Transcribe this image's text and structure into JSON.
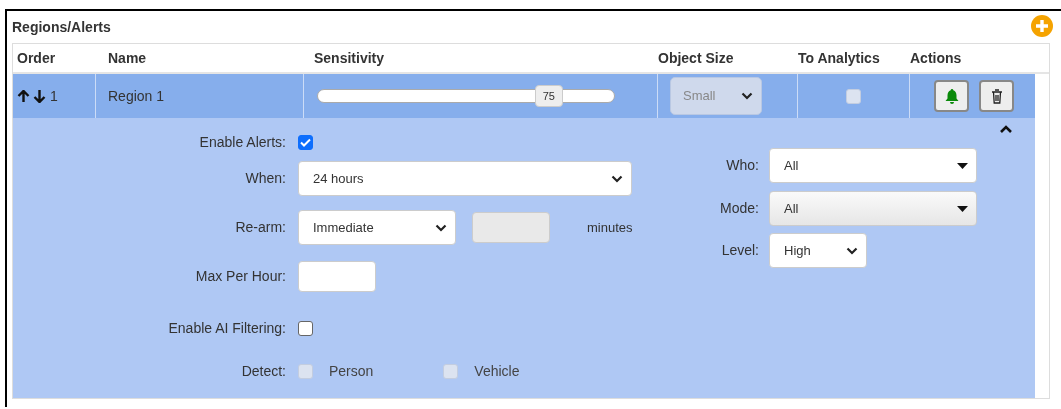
{
  "title": "Regions/Alerts",
  "table": {
    "columns": [
      "Order",
      "Name",
      "Sensitivity",
      "Object Size",
      "To Analytics",
      "Actions"
    ],
    "rows": [
      {
        "order": "1",
        "name": "Region 1",
        "selected": true,
        "expanded": true,
        "sensitivity": {
          "level": 0.78,
          "reading": "75"
        },
        "object_size": {
          "value": "Small",
          "disabled": true
        },
        "to_analytics": {
          "checked": false,
          "disabled": true
        },
        "alerts_on": true
      }
    ]
  },
  "alert_settings": {
    "enable_alerts": {
      "label": "Enable Alerts:",
      "checked": true
    },
    "when": {
      "label": "When:",
      "value": "24 hours"
    },
    "rearm": {
      "label": "Re-arm:",
      "value": "Immediate",
      "minutes_disabled": true,
      "units": "minutes"
    },
    "max_per_hour": {
      "label": "Max Per Hour:"
    },
    "enable_ai_filtering": {
      "label": "Enable AI Filtering:",
      "checked": false
    },
    "detect": {
      "label": "Detect:",
      "options": [
        {
          "label": "Person",
          "checked": false,
          "disabled": true
        },
        {
          "label": "Vehicle",
          "checked": false,
          "disabled": true
        }
      ]
    },
    "who": {
      "label": "Who:",
      "value": "All"
    },
    "mode": {
      "label": "Mode:",
      "value": "All"
    },
    "level": {
      "label": "Level:",
      "value": "High"
    }
  }
}
